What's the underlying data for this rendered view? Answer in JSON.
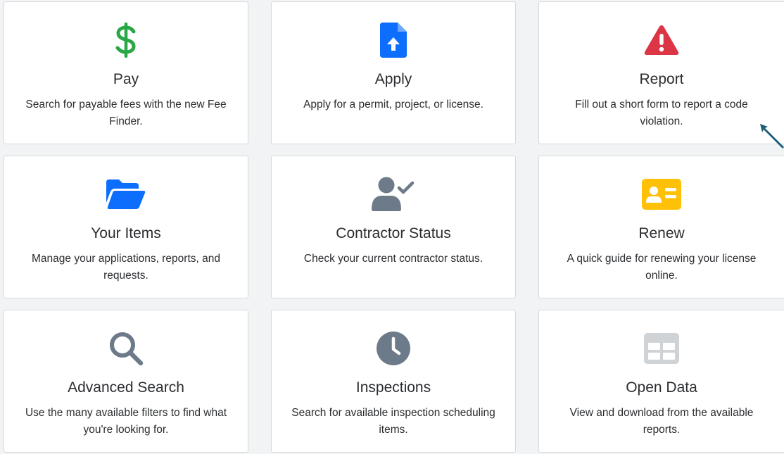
{
  "colors": {
    "pay_icon": "#28a745",
    "apply_icon": "#0d6efd",
    "report_icon": "#dc3545",
    "items_icon": "#0d6efd",
    "contractor_icon": "#6c7a89",
    "renew_icon": "#ffc107",
    "search_icon": "#6c7a89",
    "inspections_icon": "#6c7a89",
    "opendata_icon": "#cfd3d6"
  },
  "cards": [
    {
      "title": "Pay",
      "desc": "Search for payable fees with the new Fee Finder.",
      "icon": "dollar-icon"
    },
    {
      "title": "Apply",
      "desc": "Apply for a permit, project, or license.",
      "icon": "file-upload-icon"
    },
    {
      "title": "Report",
      "desc": "Fill out a short form to report a code violation.",
      "icon": "warning-icon"
    },
    {
      "title": "Your Items",
      "desc": "Manage your applications, reports, and requests.",
      "icon": "folder-icon"
    },
    {
      "title": "Contractor Status",
      "desc": "Check your current contractor status.",
      "icon": "user-check-icon"
    },
    {
      "title": "Renew",
      "desc": "A quick guide for renewing your license online.",
      "icon": "id-card-icon"
    },
    {
      "title": "Advanced Search",
      "desc": "Use the many available filters to find what you're looking for.",
      "icon": "search-icon"
    },
    {
      "title": "Inspections",
      "desc": "Search for available inspection scheduling items.",
      "icon": "clock-icon"
    },
    {
      "title": "Open Data",
      "desc": "View and download from the available reports.",
      "icon": "table-icon"
    }
  ]
}
